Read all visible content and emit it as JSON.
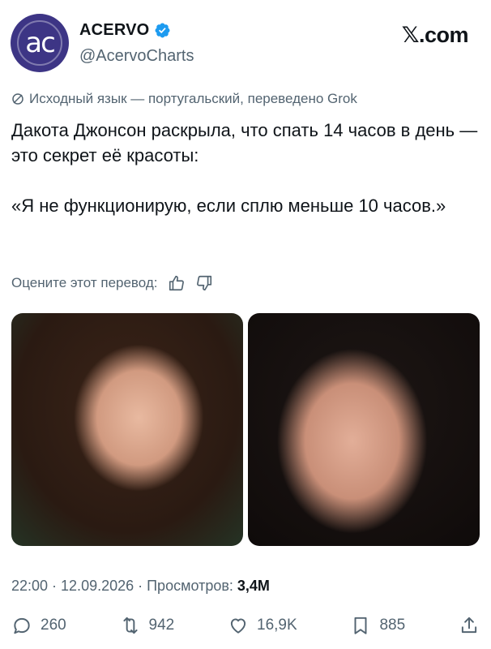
{
  "author": {
    "avatar_text": "ac",
    "name": "ACERVO",
    "handle": "@AcervoCharts",
    "verified": true
  },
  "brand": "𝕏.com",
  "translation_note": "Исходный язык — португальский, переведено Grok",
  "post": {
    "line1": "Дакота Джонсон раскрыла, что спать 14 часов в день — это секрет её красоты:",
    "line2": "«Я не функционирую, если сплю меньше 10 часов.»"
  },
  "rate": {
    "label": "Оцените этот перевод:",
    "icons": [
      "thumbs-up-icon",
      "thumbs-down-icon"
    ]
  },
  "media": [
    {
      "name": "photo-left"
    },
    {
      "name": "photo-right"
    }
  ],
  "meta": {
    "time": "22:00 · 12.09.2026 · Просмотров: ",
    "views": "3,4M"
  },
  "actions": {
    "replies": "260",
    "reposts": "942",
    "likes": "16,9K",
    "bookmarks": "885"
  },
  "colors": {
    "text": "#0f1419",
    "secondary": "#536471",
    "verified": "#1d9bf0",
    "avatar": "#3d3585"
  }
}
